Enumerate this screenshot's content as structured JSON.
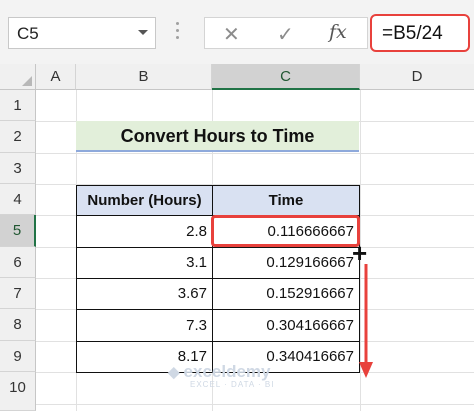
{
  "formula_bar": {
    "name_box": "C5",
    "cancel_icon": "✕",
    "enter_icon": "✓",
    "fx_label": "fx",
    "formula": "=B5/24"
  },
  "columns": [
    "A",
    "B",
    "C",
    "D"
  ],
  "rows": [
    "1",
    "2",
    "3",
    "4",
    "5",
    "6",
    "7",
    "8",
    "9",
    "10"
  ],
  "title": "Convert Hours to Time",
  "table": {
    "headers": [
      "Number (Hours)",
      "Time"
    ],
    "rows": [
      [
        "2.8",
        "0.116666667"
      ],
      [
        "3.1",
        "0.129166667"
      ],
      [
        "3.67",
        "0.152916667"
      ],
      [
        "7.3",
        "0.304166667"
      ],
      [
        "8.17",
        "0.340416667"
      ]
    ]
  },
  "fill_handle_icon": "+",
  "watermark": {
    "name": "exceldemy",
    "tagline": "EXCEL · DATA · BI"
  },
  "colors": {
    "highlight": "#e8413c",
    "title_fill": "#e2efda",
    "header_fill": "#d9e1f2",
    "excel_green": "#217346"
  }
}
